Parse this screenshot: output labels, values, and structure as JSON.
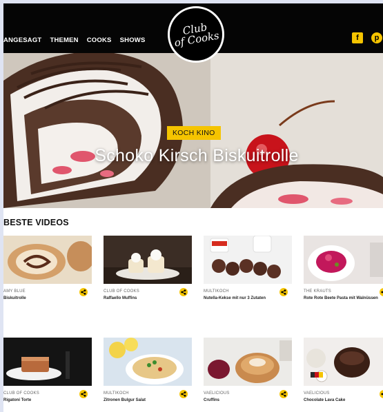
{
  "nav": {
    "links": [
      "ANGESAGT",
      "THEMEN",
      "COOKS",
      "SHOWS"
    ],
    "logo_text_line1": "Club",
    "logo_text_line2": "of Cooks",
    "social": {
      "facebook": "f",
      "pinterest": "p"
    }
  },
  "hero": {
    "tag": "KOCH KINO",
    "title": "Schoko Kirsch Biskuitrolle"
  },
  "section": {
    "title": "BESTE VIDEOS"
  },
  "videos": [
    {
      "author": "AMY BLUE",
      "title": "Biskuitrolle"
    },
    {
      "author": "CLUB OF COOKS",
      "title": "Raffaello Muffins"
    },
    {
      "author": "MULTIKOCH",
      "title": "Nutella-Kekse mit nur 3 Zutaten"
    },
    {
      "author": "THE KRAUTS",
      "title": "Rote Rote Beete Pasta mit Walnüssen"
    },
    {
      "author": "CLUB OF COOKS",
      "title": "Rigatoni Torte"
    },
    {
      "author": "MULTIKOCH",
      "title": "Zitronen Bulgur Salat"
    },
    {
      "author": "VAELICIOUS",
      "title": "Cruffins"
    },
    {
      "author": "VAELICIOUS",
      "title": "Chocolate Lava Cake"
    }
  ],
  "colors": {
    "accent": "#f5c400",
    "nav_bg": "#050505"
  }
}
